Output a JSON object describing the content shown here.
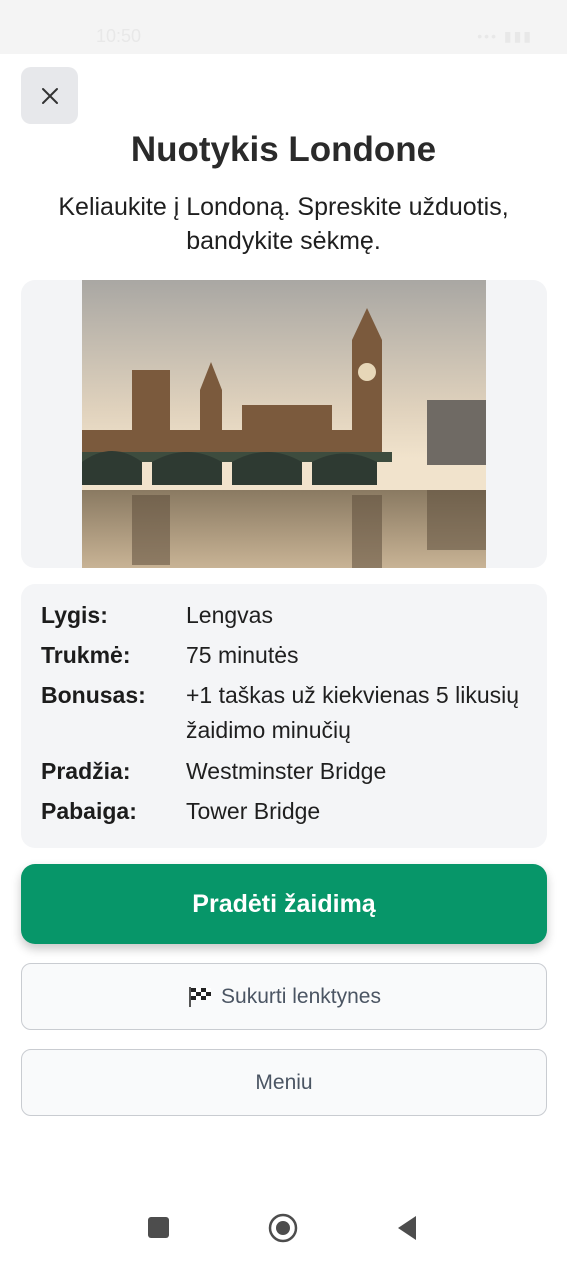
{
  "status_bar": {
    "time": "10:50",
    "right": "•••  ▮▮▮"
  },
  "header": {
    "title": "Nuotykis Londone",
    "subtitle": "Keliaukite į Londoną. Spreskite užduotis, bandykite sėkmę."
  },
  "image": {
    "icon": "london-parliament-photo"
  },
  "info": {
    "rows": [
      {
        "label": "Lygis:",
        "value": "Lengvas"
      },
      {
        "label": "Trukmė:",
        "value": "75 minutės"
      },
      {
        "label": "Bonusas:",
        "value": "+1 taškas už kiekvienas 5 likusių žaidimo minučių"
      },
      {
        "label": "Pradžia:",
        "value": "Westminster Bridge"
      },
      {
        "label": "Pabaiga:",
        "value": "Tower Bridge"
      }
    ]
  },
  "actions": {
    "start_label": "Pradėti žaidimą",
    "race_label": "Sukurti lenktynes",
    "menu_label": "Meniu"
  },
  "colors": {
    "primary": "#079669",
    "card_bg": "#f4f5f7"
  }
}
